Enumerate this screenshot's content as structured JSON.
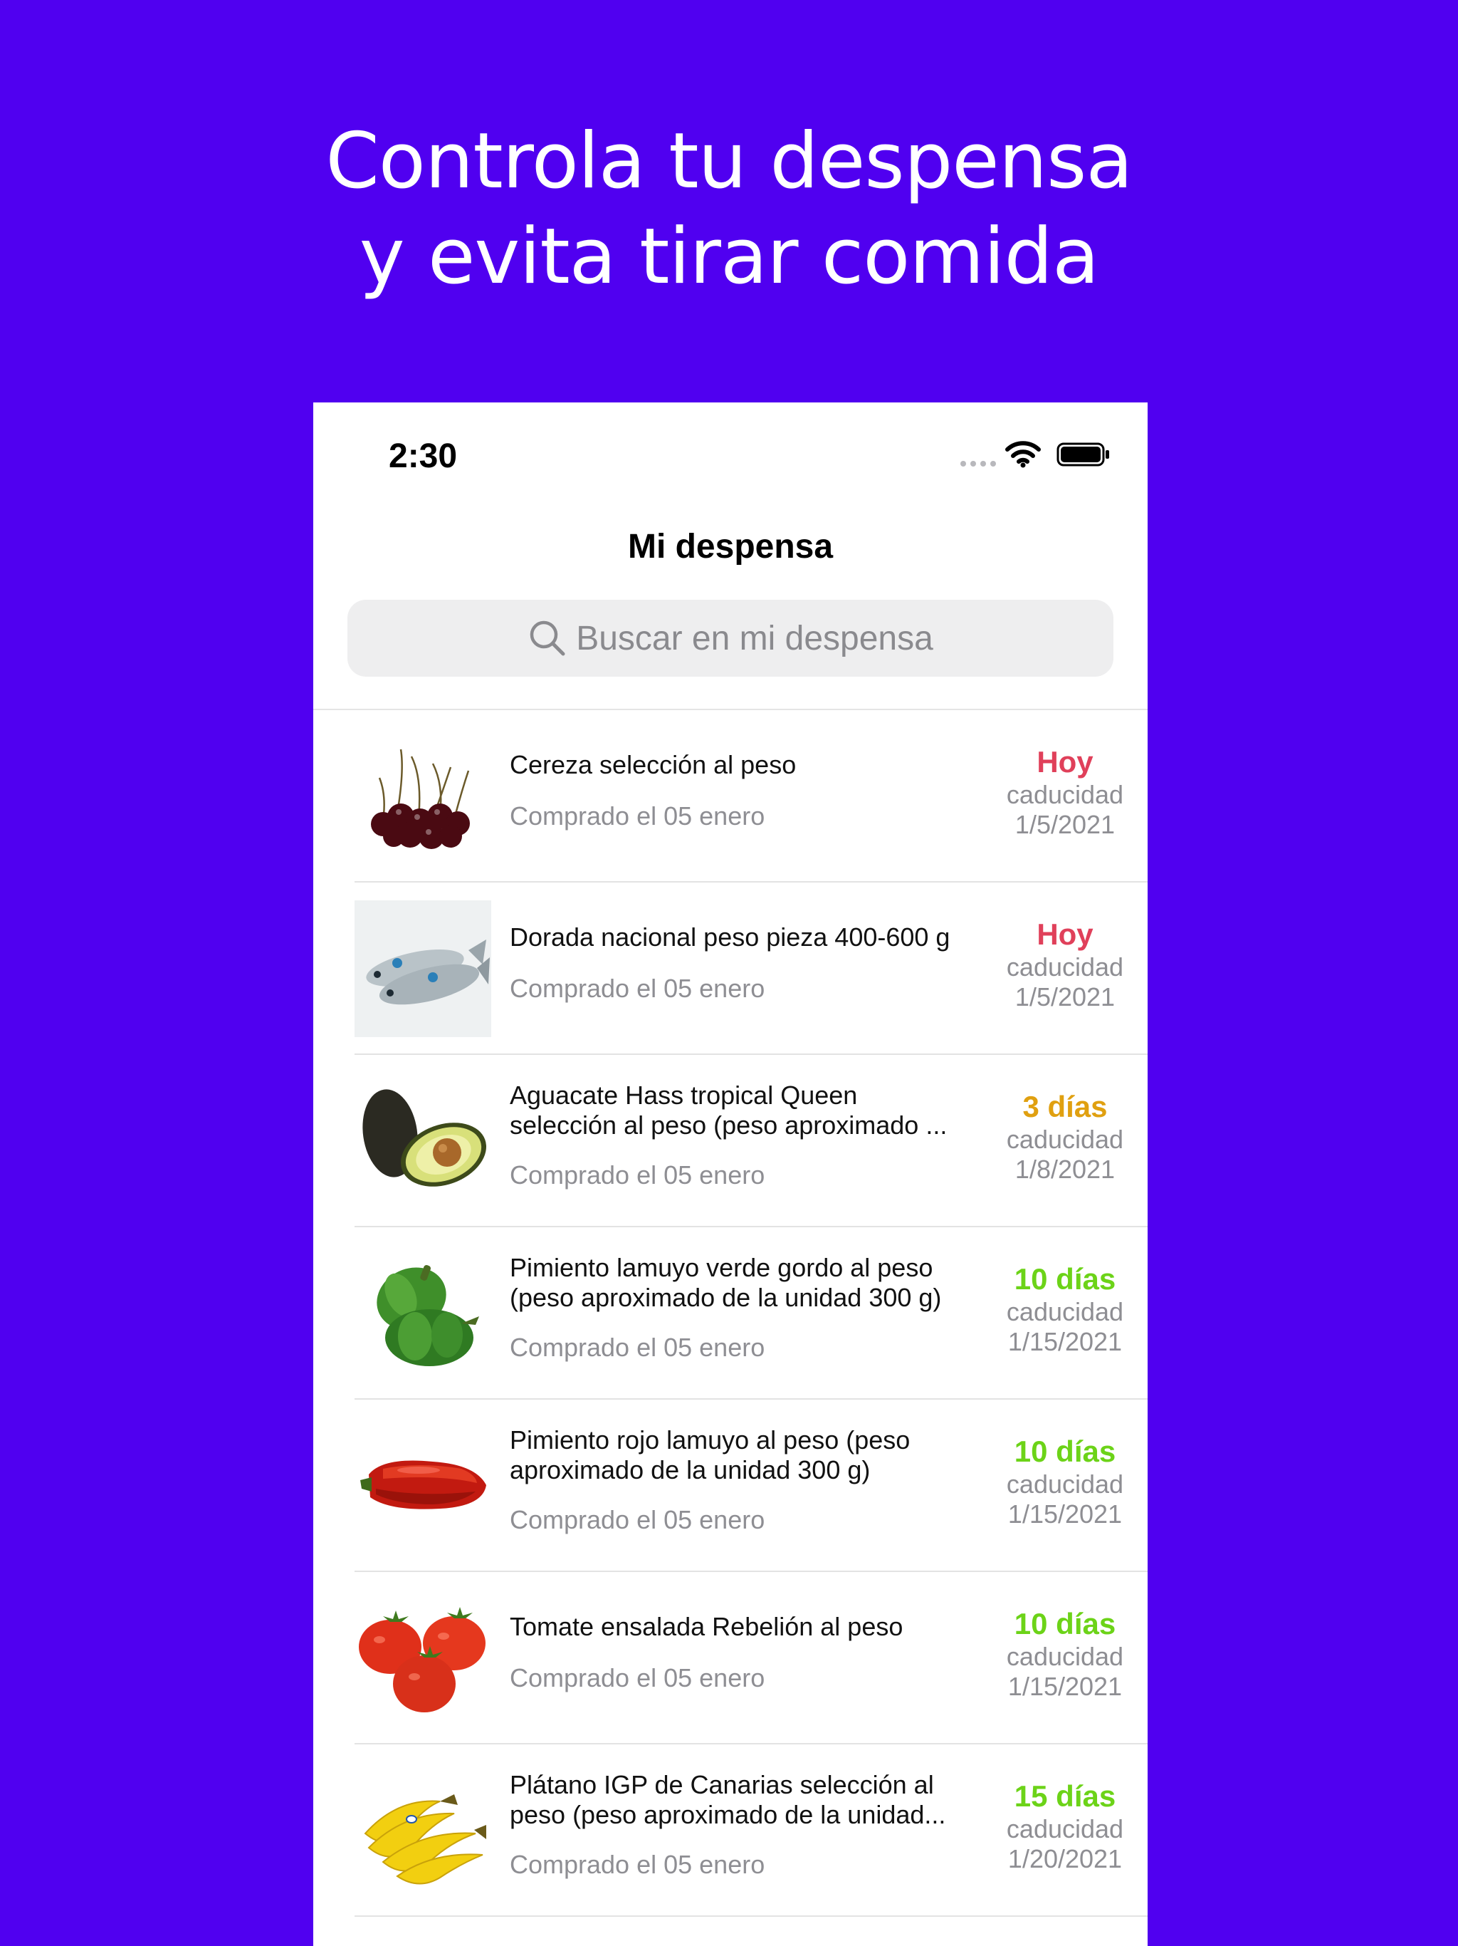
{
  "headline": {
    "line1": "Controla tu despensa",
    "line2": "y evita tirar comida"
  },
  "status_bar": {
    "time": "2:30"
  },
  "nav": {
    "title": "Mi despensa"
  },
  "search": {
    "placeholder": "Buscar en mi despensa",
    "icon": "search-icon"
  },
  "colors": {
    "background": "#5000f0",
    "today": "#e0405a",
    "soon": "#e0a010",
    "ok": "#6cd318"
  },
  "items": [
    {
      "name": "Cereza selección al peso",
      "purchased": "Comprado el 05 enero",
      "badge": "Hoy",
      "badge_color": "#e0405a",
      "expiry_label": "caducidad",
      "expiry_date": "1/5/2021",
      "image": "cherries"
    },
    {
      "name": "Dorada nacional peso pieza 400-600 g",
      "purchased": "Comprado el 05 enero",
      "badge": "Hoy",
      "badge_color": "#e0405a",
      "expiry_label": "caducidad",
      "expiry_date": "1/5/2021",
      "image": "fish"
    },
    {
      "name": "Aguacate Hass tropical Queen\nselección al peso (peso aproximado ...",
      "purchased": "Comprado el 05 enero",
      "badge": "3 días",
      "badge_color": "#e0a010",
      "expiry_label": "caducidad",
      "expiry_date": "1/8/2021",
      "image": "avocado"
    },
    {
      "name": "Pimiento lamuyo verde gordo al peso\n(peso aproximado de la unidad 300 g)",
      "purchased": "Comprado el 05 enero",
      "badge": "10 días",
      "badge_color": "#6cd318",
      "expiry_label": "caducidad",
      "expiry_date": "1/15/2021",
      "image": "green-pepper"
    },
    {
      "name": "Pimiento rojo lamuyo al peso (peso\naproximado de la unidad 300 g)",
      "purchased": "Comprado el 05 enero",
      "badge": "10 días",
      "badge_color": "#6cd318",
      "expiry_label": "caducidad",
      "expiry_date": "1/15/2021",
      "image": "red-pepper"
    },
    {
      "name": "Tomate ensalada Rebelión al peso",
      "purchased": "Comprado el 05 enero",
      "badge": "10 días",
      "badge_color": "#6cd318",
      "expiry_label": "caducidad",
      "expiry_date": "1/15/2021",
      "image": "tomatoes"
    },
    {
      "name": "Plátano IGP de Canarias selección al\npeso (peso aproximado de la unidad...",
      "purchased": "Comprado el 05 enero",
      "badge": "15 días",
      "badge_color": "#6cd318",
      "expiry_label": "caducidad",
      "expiry_date": "1/20/2021",
      "image": "bananas"
    }
  ]
}
